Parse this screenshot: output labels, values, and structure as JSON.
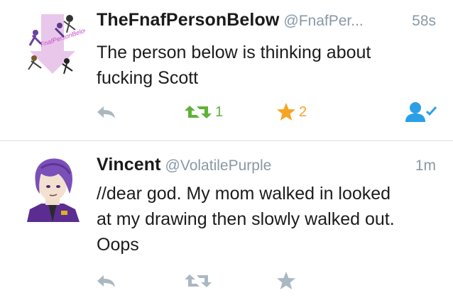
{
  "tweets": [
    {
      "name": "TheFnafPersonBelow",
      "handle": "@FnafPer...",
      "time": "58s",
      "text_lines": [
        "The person below is thinking about",
        "fucking Scott"
      ],
      "retweet_count": "1",
      "favorite_count": "2",
      "retweeted": true,
      "favorited": true,
      "avatar_icon": "fnaf-collage-avatar",
      "avatar_text": "FnafPersonBelow"
    },
    {
      "name": "Vincent",
      "handle": "@VolatilePurple",
      "time": "1m",
      "text_lines": [
        "//dear god. My mom walked in looked",
        "at my drawing then slowly walked out.",
        "Oops"
      ],
      "retweet_count": "",
      "favorite_count": "",
      "retweeted": false,
      "favorited": false,
      "avatar_icon": "purple-guy-avatar"
    }
  ],
  "icons": {
    "reply": "reply-icon",
    "retweet": "retweet-icon",
    "favorite": "star-icon",
    "follow": "follow-user-icon"
  },
  "colors": {
    "handle_gray": "#8899a6",
    "icon_gray": "#aab8c2",
    "retweet_green": "#5fb336",
    "favorite_orange": "#f5a524",
    "follow_blue": "#2b9fe6",
    "avatar_purple": "#6b3fa0"
  }
}
